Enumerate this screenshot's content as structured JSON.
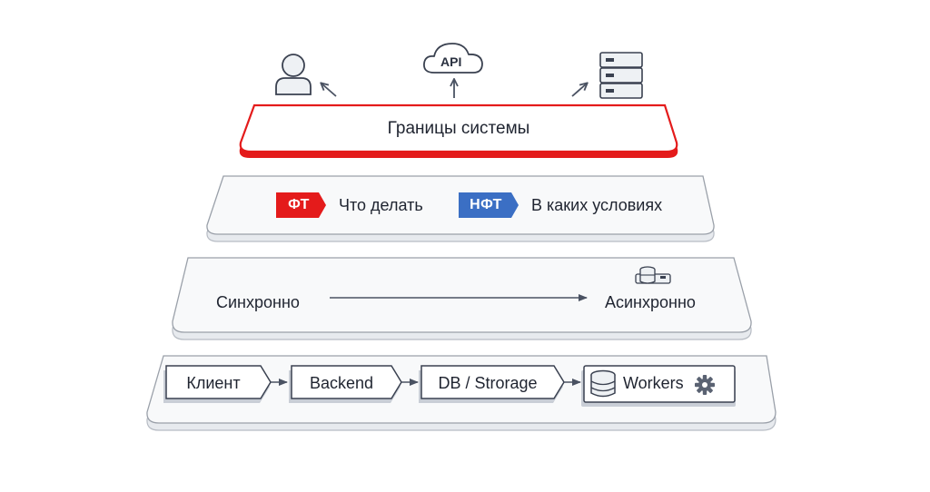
{
  "diagram": {
    "top_icons": {
      "user": "user-icon",
      "api_label": "API",
      "server": "server-icon"
    },
    "boundary": {
      "label": "Границы системы",
      "accent": "#e41b1b"
    },
    "requirements": {
      "ft": {
        "tag": "ФТ",
        "text": "Что делать",
        "color": "#e41b1b"
      },
      "nft": {
        "tag": "НФТ",
        "text": "В каких условиях",
        "color": "#3b6fc4"
      }
    },
    "sync_layer": {
      "left": "Синхронно",
      "right": "Асинхронно",
      "icon": "database-server-icon"
    },
    "flow": [
      {
        "label": "Клиент"
      },
      {
        "label": "Backend"
      },
      {
        "label": "DB / Strorage"
      },
      {
        "label": "Workers",
        "icon_left": "database-icon",
        "icon_right": "gear-icon"
      }
    ]
  }
}
